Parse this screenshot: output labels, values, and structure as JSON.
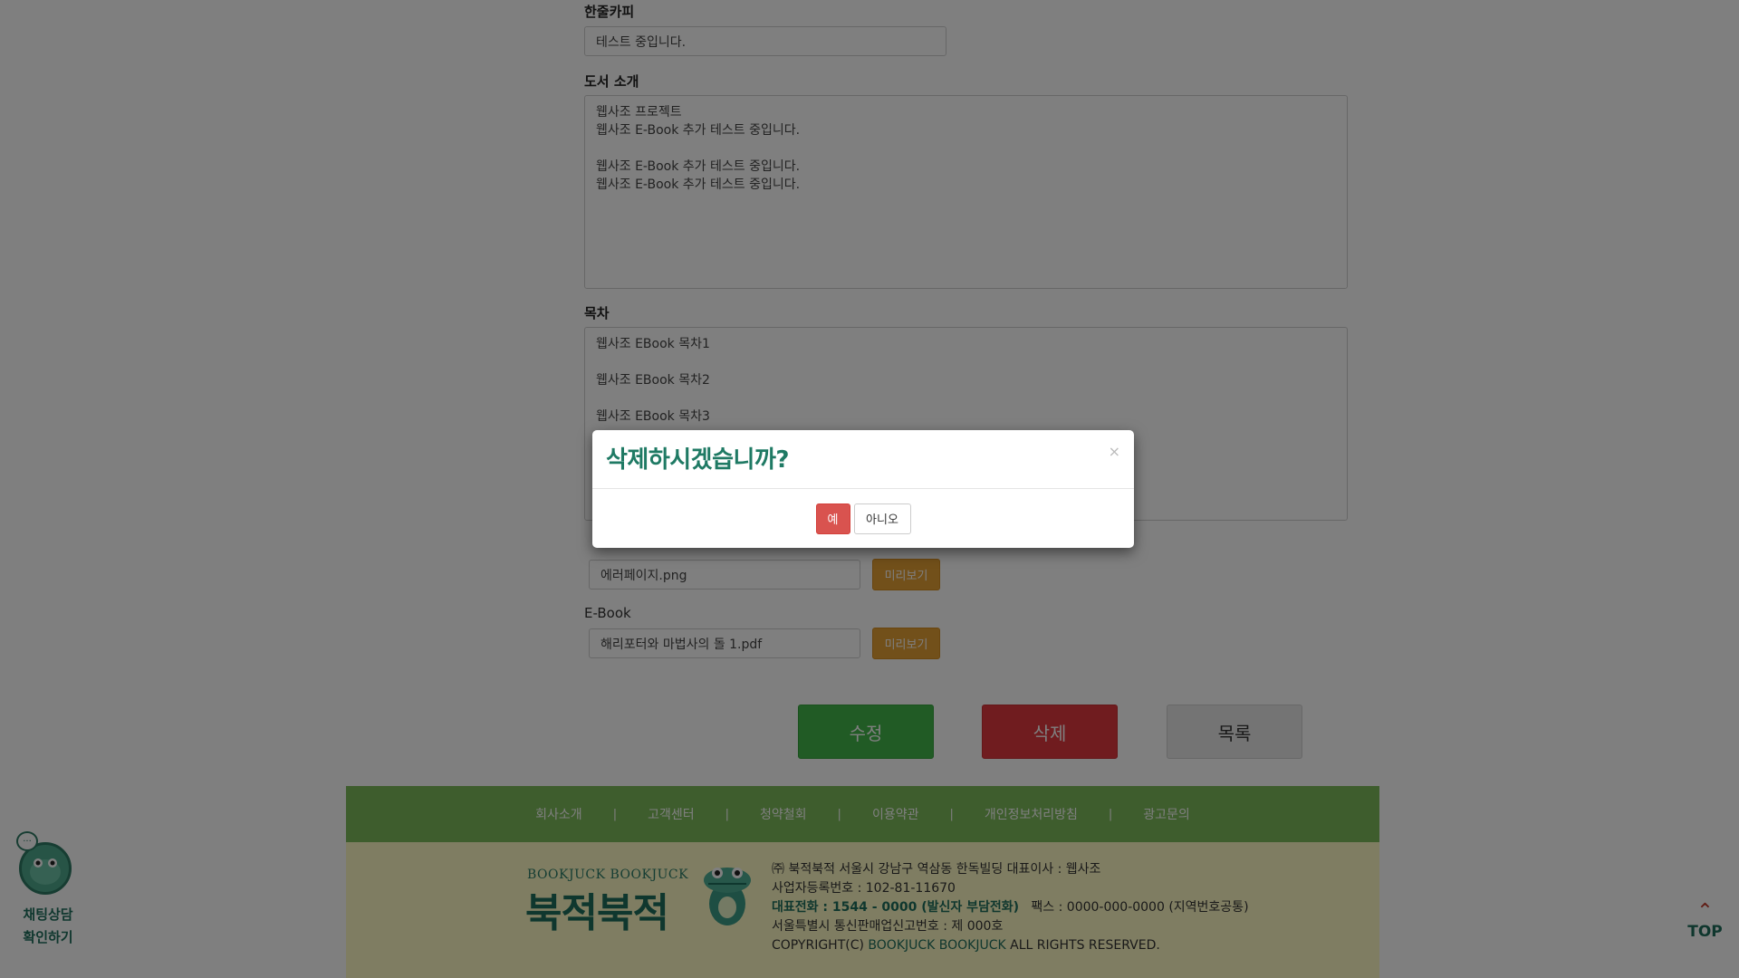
{
  "form": {
    "copy_label": "한줄카피",
    "copy_value": "테스트 중입니다.",
    "intro_label": "도서 소개",
    "intro_value": "웹사조 프로젝트\n웹사조 E-Book 추가 테스트 중입니다.\n\n웹사조 E-Book 추가 테스트 중입니다.\n웹사조 E-Book 추가 테스트 중입니다.",
    "toc_label": "목차",
    "toc_value": "웹사조 EBook 목차1\n\n웹사조 EBook 목차2\n\n웹사조 EBook 목차3",
    "image_file": "에러페이지.png",
    "ebook_label": "E-Book",
    "ebook_file": "해리포터와 마법사의 돌 1.pdf",
    "preview_label": "미리보기"
  },
  "actions": {
    "edit": "수정",
    "delete": "삭제",
    "list": "목록"
  },
  "footer": {
    "nav": [
      "회사소개",
      "고객센터",
      "청약철회",
      "이용약관",
      "개인정보처리방침",
      "광고문의"
    ],
    "separator": "|",
    "logo_small": "BOOKJUCK BOOKJUCK",
    "logo_big": "북적북적",
    "line1": "㈜ 북적북적   서울시 강남구 역삼동 한독빌딩   대표이사 : 웹사조",
    "line2": "사업자등록번호 : 102-81-11670",
    "line3_hl": "대표전화 : 1544 - 0000 (발신자 부담전화)",
    "line3_rest": "   팩스 : 0000-000-0000 (지역번호공통)",
    "line4": "서울특별시 통신판매업신고번호 : 제 000호",
    "line5_pre": "COPYRIGHT(C) ",
    "line5_hl": "BOOKJUCK BOOKJUCK",
    "line5_post": " ALL RIGHTS RESERVED."
  },
  "chat": {
    "bubble": "···",
    "label_1": "채팅상담",
    "label_2": "확인하기"
  },
  "top": {
    "arrow": "⌃",
    "label": "TOP"
  },
  "modal": {
    "title": "삭제하시겠습니까?",
    "close": "×",
    "yes": "예",
    "no": "아니오"
  },
  "colors": {
    "brand_green": "#1f7a64",
    "footer_nav_bg": "#7dbb5b",
    "footer_info_bg": "#fffbc5",
    "edit_btn": "#43b74b",
    "delete_btn": "#e0393e",
    "preview_btn": "#e5a035",
    "modal_yes": "#d9534f"
  }
}
